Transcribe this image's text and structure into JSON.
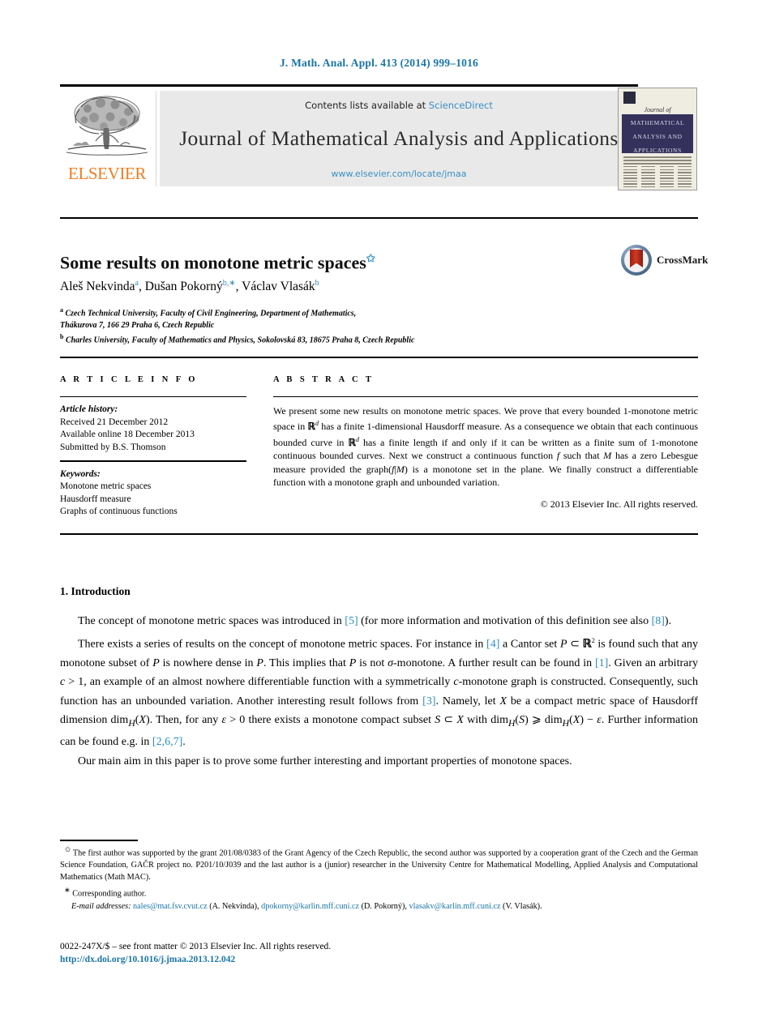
{
  "running_head": "J. Math. Anal. Appl. 413 (2014) 999–1016",
  "masthead": {
    "contents_prefix": "Contents lists available at ",
    "sciencedirect": "ScienceDirect",
    "journal_title": "Journal of Mathematical Analysis and Applications",
    "journal_url": "www.elsevier.com/locate/jmaa",
    "publisher": "ELSEVIER",
    "publisher_color": "#ef7d21",
    "link_color": "#3a8fc4",
    "banner_bg": "#e9e9e9",
    "cover": {
      "script_line": "Journal of",
      "band_line1": "MATHEMATICAL",
      "band_line2": "ANALYSIS AND",
      "band_line3": "APPLICATIONS",
      "band_color": "#34325c"
    }
  },
  "article": {
    "title": "Some results on monotone metric spaces",
    "title_footnote_mark": "✩",
    "authors": [
      {
        "name": "Aleš Nekvinda",
        "marks": "a"
      },
      {
        "name": "Dušan Pokorný",
        "marks": "b,∗"
      },
      {
        "name": "Václav Vlasák",
        "marks": "b"
      }
    ],
    "affiliations": [
      {
        "mark": "a",
        "text": "Czech Technical University, Faculty of Civil Engineering, Department of Mathematics,"
      },
      {
        "mark": "",
        "text": "Thákurova 7, 166 29 Praha 6, Czech Republic"
      },
      {
        "mark": "b",
        "text": "Charles University, Faculty of Mathematics and Physics, Sokolovská 83, 18675 Praha 8, Czech Republic"
      }
    ],
    "crossmark_label": "CrossMark"
  },
  "info": {
    "heading": "A R T I C L E   I N F O",
    "history_label": "Article history:",
    "history": [
      "Received 21 December 2012",
      "Available online 18 December 2013",
      "Submitted by B.S. Thomson"
    ],
    "keywords_label": "Keywords:",
    "keywords": [
      "Monotone metric spaces",
      "Hausdorff measure",
      "Graphs of continuous functions"
    ]
  },
  "abstract": {
    "heading": "A B S T R A C T",
    "copyright": "© 2013 Elsevier Inc. All rights reserved."
  },
  "body": {
    "section_number_title": "1. Introduction"
  },
  "footnotes": {
    "corresponding_author": "Corresponding author.",
    "email_label": "E-mail addresses:",
    "emails": [
      {
        "address": "nales@mat.fsv.cvut.cz",
        "owner": "(A. Nekvinda)"
      },
      {
        "address": "dpokorny@karlin.mff.cuni.cz",
        "owner": "(D. Pokorný)"
      },
      {
        "address": "vlasakv@karlin.mff.cuni.cz",
        "owner": "(V. Vlasák)"
      }
    ]
  },
  "footer": {
    "front_matter": "0022-247X/$ – see front matter © 2013 Elsevier Inc. All rights reserved.",
    "doi": "http://dx.doi.org/10.1016/j.jmaa.2013.12.042"
  }
}
